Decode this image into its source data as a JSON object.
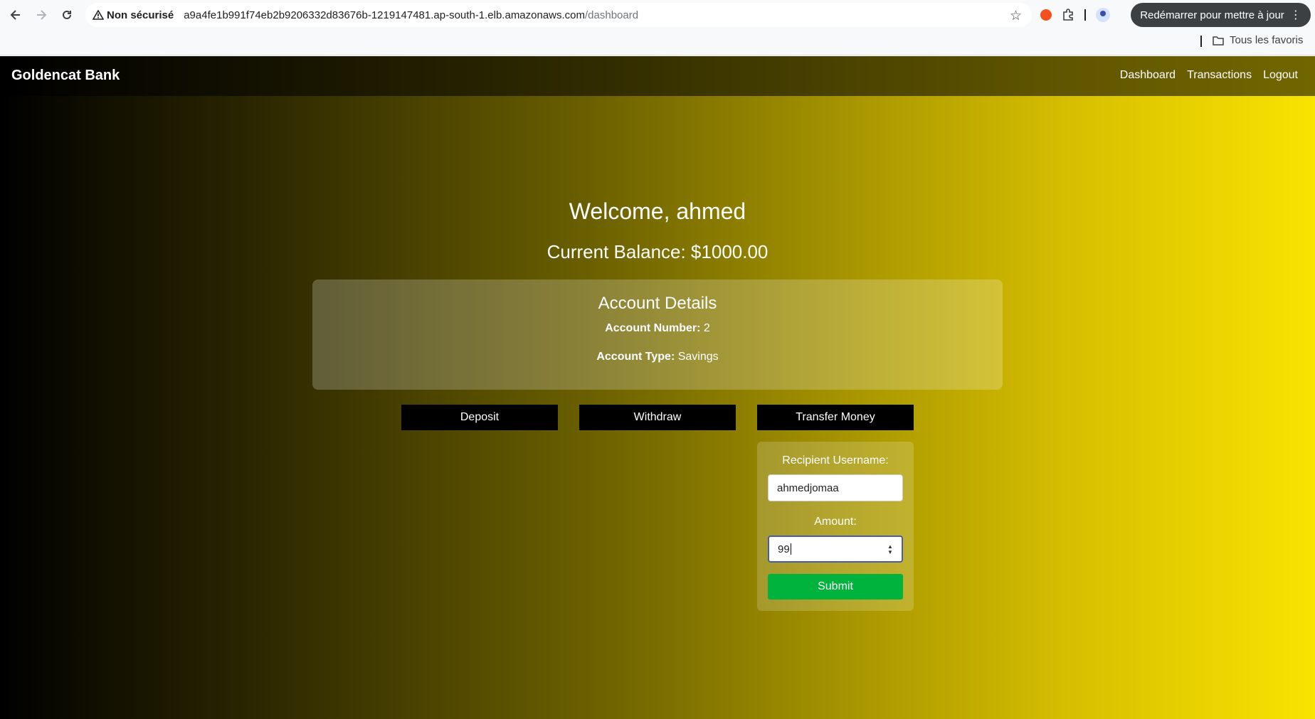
{
  "browser": {
    "security_label": "Non sécurisé",
    "url_host": "a9a4fe1b991f74eb2b9206332d83676b-1219147481.ap-south-1.elb.amazonaws.com",
    "url_path": "/dashboard",
    "restart_label": "Redémarrer pour mettre à jour",
    "bookmarks_folder": "Tous les favoris"
  },
  "app": {
    "brand": "Goldencat Bank",
    "nav": {
      "dashboard": "Dashboard",
      "transactions": "Transactions",
      "logout": "Logout"
    }
  },
  "dashboard": {
    "welcome": "Welcome, ahmed",
    "balance": "Current Balance: $1000.00",
    "details_title": "Account Details",
    "account_number_label": "Account Number:",
    "account_number_value": "2",
    "account_type_label": "Account Type:",
    "account_type_value": "Savings"
  },
  "actions": {
    "deposit": "Deposit",
    "withdraw": "Withdraw",
    "transfer": "Transfer Money"
  },
  "transfer_form": {
    "recipient_label": "Recipient Username:",
    "recipient_value": "ahmedjomaa",
    "amount_label": "Amount:",
    "amount_value": "99",
    "submit": "Submit"
  },
  "colors": {
    "submit": "#00b33c",
    "gradient_end": "#f9e300"
  }
}
